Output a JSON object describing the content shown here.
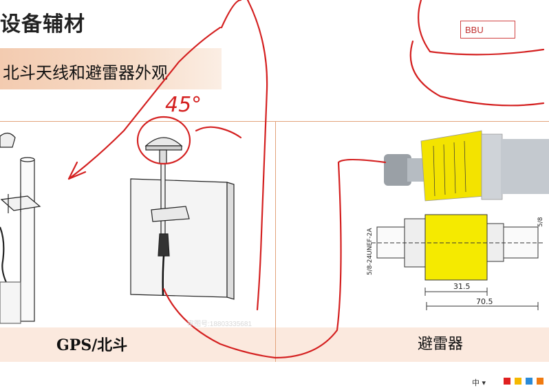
{
  "slide": {
    "title": "设备辅材",
    "subtitle": "北斗天线和避雷器外观"
  },
  "table": {
    "captions": [
      "GPS/北斗",
      "避雷器"
    ]
  },
  "annotations": {
    "handwritten_angle": "45°",
    "bbu_label": "BBU"
  },
  "drawing_labels": {
    "left_dim": "5/8-24UNEF-2A",
    "right_dim": "5/8",
    "dim_inner": "31.5",
    "dim_outer": "70.5"
  },
  "watermark": "审图号:18803335681",
  "taskbar": {
    "ime": "中 ▾",
    "tray_colors": [
      "#e02020",
      "#f5b800",
      "#2a8ad8",
      "#f07a10"
    ]
  },
  "colors": {
    "ink": "#d42020",
    "table_line": "#e2a27a",
    "header_fill": "#f3cbb0",
    "label_yellow": "#f3e300"
  }
}
